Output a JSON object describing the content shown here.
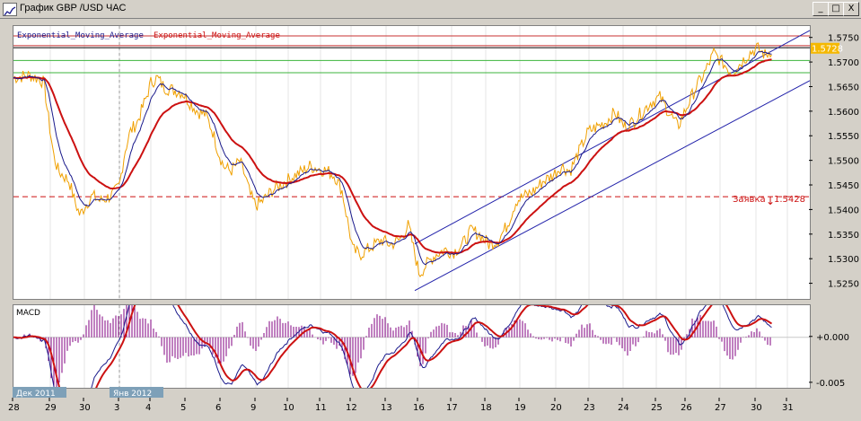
{
  "window": {
    "title": "График GBP /USD  ЧАС",
    "controls": {
      "minimize": "_",
      "maximize": "□",
      "close": "X"
    }
  },
  "legend": {
    "ema_fast": "Exponential_Moving_Average",
    "ema_slow": "Exponential_Moving_Average",
    "ema_fast_color": "#1a1a8c",
    "ema_slow_color": "#cc1111"
  },
  "price_axis": {
    "ticks": [
      "1.5750",
      "1.5700",
      "1.5650",
      "1.5600",
      "1.5550",
      "1.5500",
      "1.5450",
      "1.5400",
      "1.5350",
      "1.5300",
      "1.5250"
    ],
    "current_price": "1.5728",
    "current_price_bg": "#f5b800"
  },
  "order": {
    "label": "Заявка",
    "price": "1.5428",
    "color": "#cc1111"
  },
  "macd": {
    "label": "MACD",
    "ticks": [
      "+0.000",
      "-0.005"
    ]
  },
  "time_axis": {
    "labels": [
      "28",
      "29",
      "30",
      "3",
      "4",
      "5",
      "6",
      "9",
      "10",
      "11",
      "12",
      "13",
      "16",
      "17",
      "18",
      "19",
      "20",
      "23",
      "24",
      "25",
      "26",
      "27",
      "30",
      "31"
    ],
    "month_markers": [
      "Дек 2011",
      "Янв 2012"
    ]
  },
  "chart_data": {
    "type": "line",
    "price_ylim": [
      1.522,
      1.5775
    ],
    "macd_ylim": [
      -0.0055,
      0.0035
    ],
    "price_series_color": "#f0a000",
    "horizontal_levels": [
      {
        "price": 1.5755,
        "color": "#c83232"
      },
      {
        "price": 1.5735,
        "color": "#c83232"
      },
      {
        "price": 1.5705,
        "color": "#3cb43c"
      },
      {
        "price": 1.568,
        "color": "#3cb43c"
      },
      {
        "price": 1.5428,
        "color": "#cc1111",
        "dashed": true
      }
    ]
  }
}
